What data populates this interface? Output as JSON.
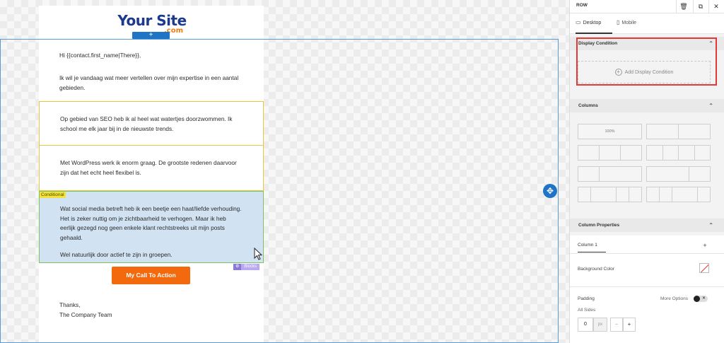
{
  "email": {
    "logo_main": "Your Site",
    "logo_sub": ".com",
    "add_row_label": "+",
    "greeting": "Hi {{contact.first_name|There}},",
    "intro": "Ik wil je vandaag wat meer vertellen over mijn expertise in een aantal gebieden.",
    "seo": "Op gebied van SEO heb ik al heel wat watertjes doorzwommen. Ik school me elk jaar bij in de nieuwste trends.",
    "wordpress": "Met WordPress werk ik enorm graag. De grootste redenen daarvoor zijn dat het echt heel flexibel is.",
    "conditional_tag": "Conditional",
    "social_p1": "Wat social media betreft heb ik een beetje een haat/liefde verhouding. Het is zeker nuttig om je zichtbaarheid te verhogen. Maar ik heb eerlijk gezegd nog geen enkele klant rechtstreeks uit mijn posts gehaald.",
    "social_p2": "Wel natuurlijk door actief te zijn in groepen.",
    "blocks_tag_icon": "⚙",
    "blocks_tag": "Blocks",
    "cta": "My Call To Action",
    "thanks": "Thanks,",
    "signature": "The Company Team"
  },
  "panel": {
    "title": "ROW",
    "tabs": {
      "desktop": "Desktop",
      "mobile": "Mobile"
    },
    "display_condition": {
      "heading": "Display Condition",
      "add_label": "Add Display Condition"
    },
    "columns": {
      "heading": "Columns",
      "single_label": "100%"
    },
    "column_properties": {
      "heading": "Column Properties",
      "column_tab": "Column 1",
      "add": "+",
      "background_color": "Background Color",
      "padding": "Padding",
      "more_options": "More Options",
      "all_sides": "All Sides",
      "padding_value": "0",
      "padding_unit": "px",
      "minus": "−",
      "plus": "+"
    }
  },
  "colors": {
    "accent": "#1f74c6",
    "cta": "#f26a0d",
    "highlight": "#e53935",
    "conditional": "#f3e23b"
  }
}
